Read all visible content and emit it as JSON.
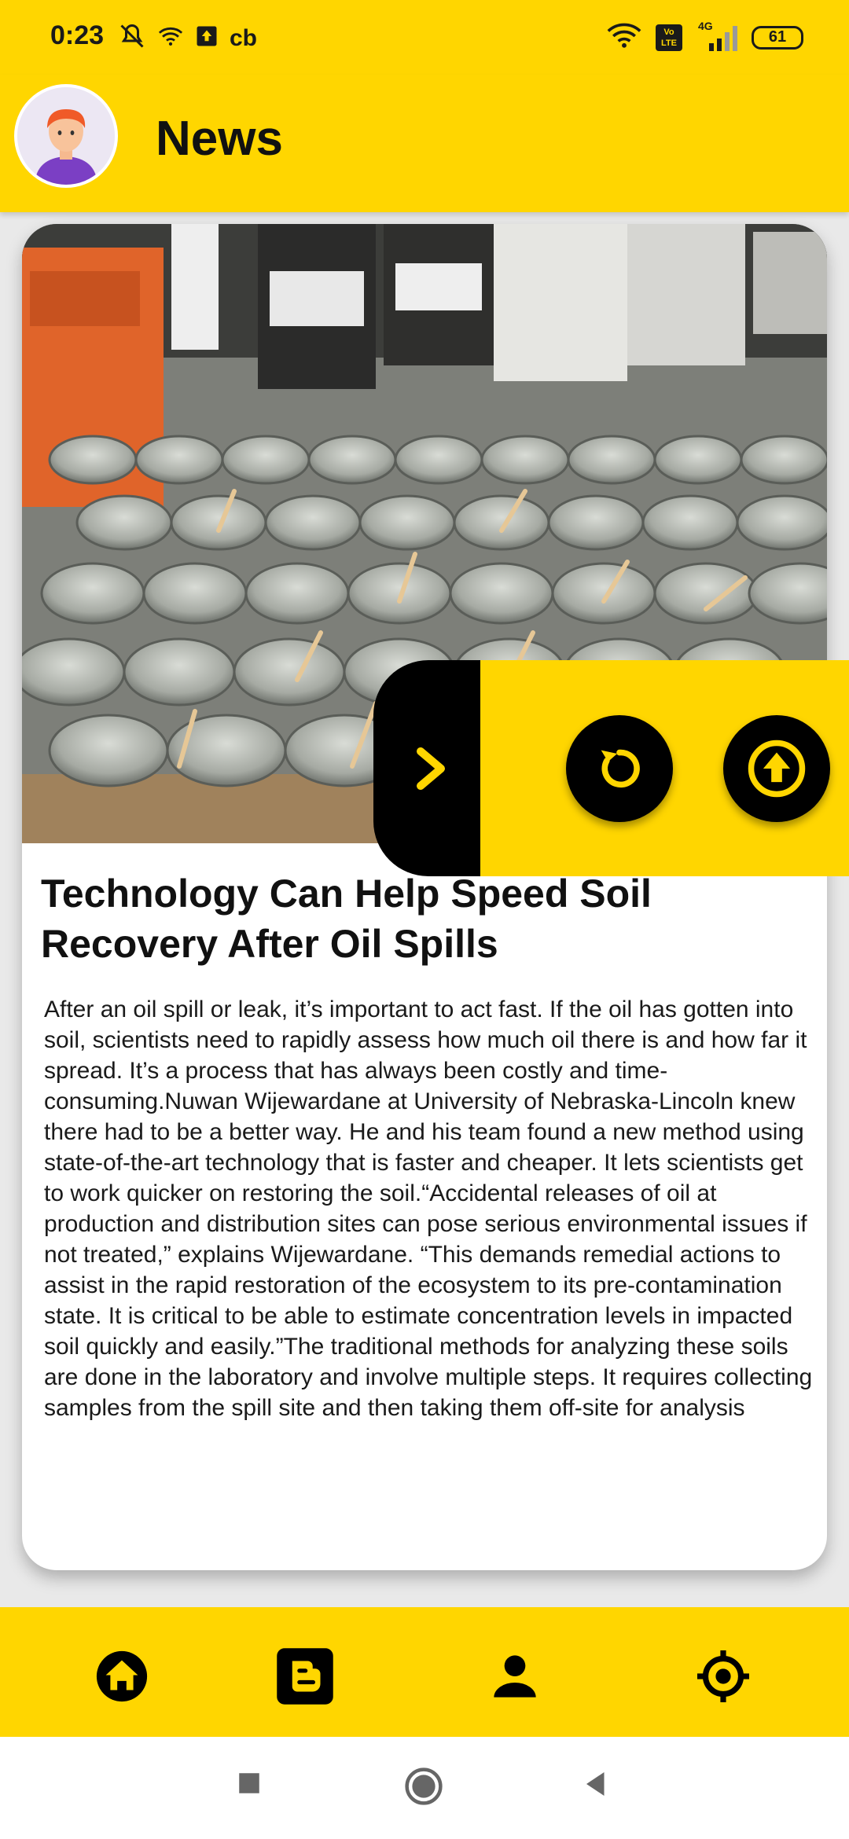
{
  "status_bar": {
    "time": "0:23",
    "left_icons": [
      "mute-icon",
      "wifi-calling-icon",
      "upload-icon",
      "cb-icon"
    ],
    "carrier_text": "cb",
    "network": "4G",
    "volte": "Vo LTE",
    "battery": "61"
  },
  "header": {
    "title": "News",
    "avatar": "user-avatar"
  },
  "article": {
    "image": "glass-jars-soil-samples-photo",
    "title": "Technology Can Help Speed Soil Recovery After Oil Spills",
    "body": "After an oil spill or leak, it’s important to act fast. If the oil has gotten into soil, scientists need to rapidly assess how much oil there is and how far it spread. It’s a process that has always been costly and time-consuming.Nuwan Wijewardane at University of Nebraska-Lincoln knew there had to be a better way. He and his team found a new method using state-of-the-art technology that is faster and cheaper. It lets scientists get to work quicker on restoring the soil.“Accidental releases of oil at production and distribution sites can pose serious environmental issues if not treated,” explains Wijewardane. “This demands remedial actions to assist in the rapid restoration of the ecosystem to its pre-contamination state. It is critical to be able to estimate concentration levels in impacted soil quickly and easily.”The traditional methods for analyzing these soils are done in the laboratory and involve multiple steps. It requires collecting samples from the spill site and then taking them off-site for analysis"
  },
  "fab_panel": {
    "toggle_icon": "chevron-right-icon",
    "buttons": [
      "refresh-icon",
      "arrow-up-circle-icon"
    ]
  },
  "bottom_nav": [
    "home-icon",
    "blogger-icon",
    "person-icon",
    "location-target-icon"
  ],
  "colors": {
    "accent": "#ffd600",
    "dark": "#000000",
    "card": "#ffffff"
  }
}
